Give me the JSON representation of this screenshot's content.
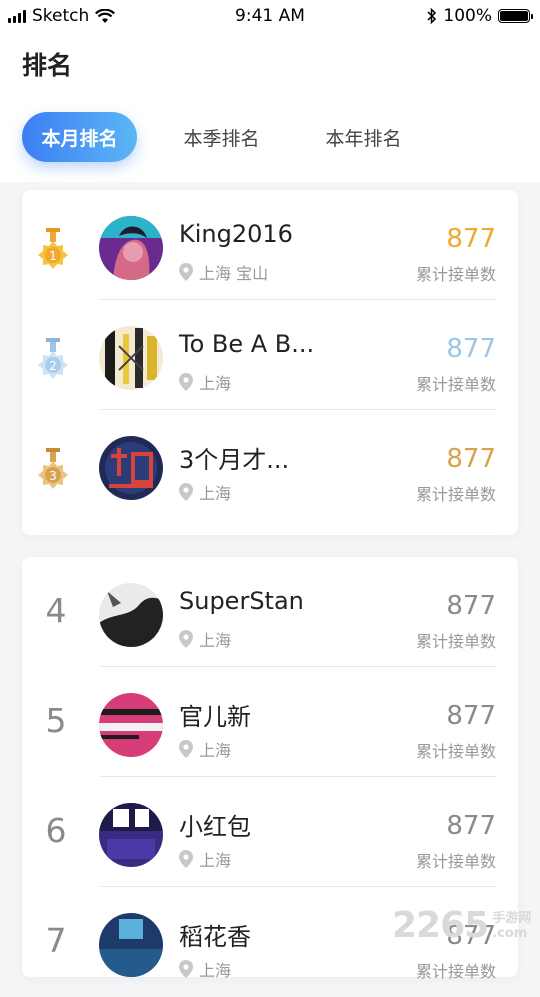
{
  "status_bar": {
    "carrier": "Sketch",
    "time": "9:41 AM",
    "battery": "100%"
  },
  "page": {
    "title": "排名"
  },
  "tabs": [
    {
      "label": "本月排名",
      "active": true
    },
    {
      "label": "本季排名",
      "active": false
    },
    {
      "label": "本年排名",
      "active": false
    }
  ],
  "count_label": "累计接单数",
  "colors": {
    "gold": "#f0a92f",
    "silver": "#9cc6e8",
    "bronze": "#d9a24e",
    "gray": "#8a8a8a",
    "accent": "#3d7ef3"
  },
  "top_ranks": [
    {
      "rank": "1",
      "medal": "gold-medal-icon",
      "name": "King2016",
      "location": "上海 宝山",
      "count": "877"
    },
    {
      "rank": "2",
      "medal": "silver-medal-icon",
      "name": "To Be A B...",
      "location": "上海",
      "count": "877"
    },
    {
      "rank": "3",
      "medal": "bronze-medal-icon",
      "name": "3个月才...",
      "location": "上海",
      "count": "877"
    }
  ],
  "other_ranks": [
    {
      "rank": "4",
      "name": "SuperStan",
      "location": "上海",
      "count": "877"
    },
    {
      "rank": "5",
      "name": "官儿新",
      "location": "上海",
      "count": "877"
    },
    {
      "rank": "6",
      "name": "小红包",
      "location": "上海",
      "count": "877"
    },
    {
      "rank": "7",
      "name": "稻花香",
      "location": "上海",
      "count": "877"
    }
  ],
  "watermark": {
    "number": "2265",
    "suffix": ".com",
    "brand": "手游网"
  }
}
